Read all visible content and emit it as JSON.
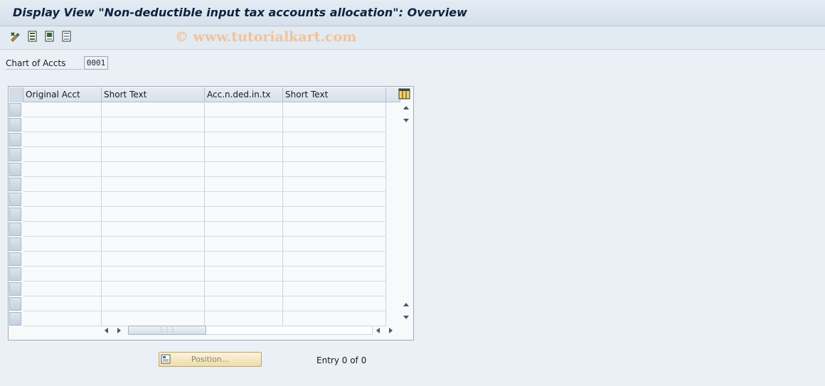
{
  "window": {
    "title": "Display View \"Non-deductible input tax accounts allocation\": Overview"
  },
  "toolbar": {
    "icons": [
      "change-display-icon",
      "select-all-icon",
      "select-block-icon",
      "deselect-all-icon"
    ]
  },
  "watermark": "© www.tutorialkart.com",
  "field": {
    "label": "Chart of Accts",
    "value": "0001"
  },
  "table": {
    "columns": [
      "Original Acct",
      "Short Text",
      "Acc.n.ded.in.tx",
      "Short Text"
    ],
    "row_count": 15,
    "rows": []
  },
  "footer": {
    "position_button": "Position...",
    "entry_text": "Entry 0 of 0"
  },
  "colors": {
    "background": "#eaf0f6",
    "title_text": "#10223d",
    "button_bg": "#efdcaa",
    "watermark": "#f1c39a"
  }
}
